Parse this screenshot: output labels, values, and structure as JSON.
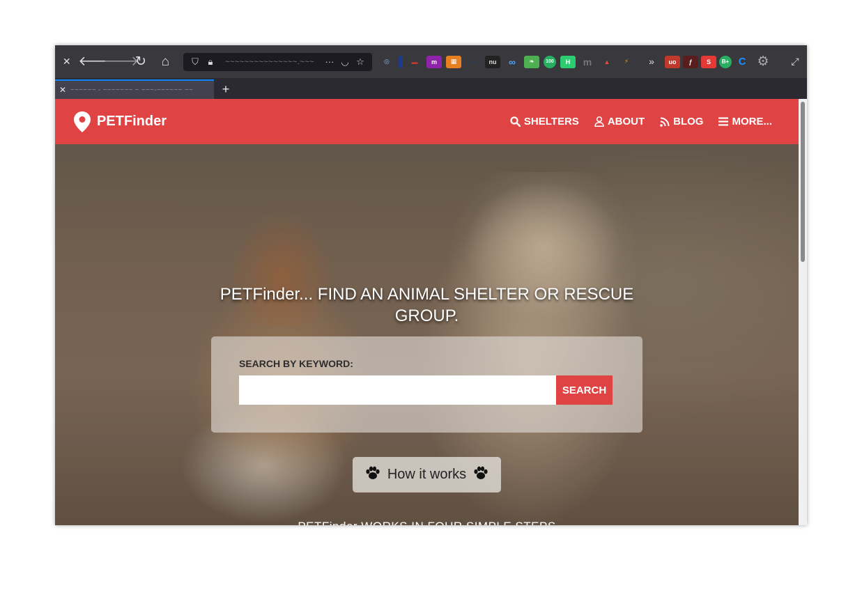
{
  "browser": {
    "tab_title": "~~~~~~ - ~~~~~~~ ~ ~~~-~~~~~~ ~~",
    "url_text": "~~~~~~~~~~~~~~~.~~~",
    "overflow_label": "···"
  },
  "navbar": {
    "brand": "PETFinder",
    "links": [
      {
        "label": "SHELTERS",
        "icon": "search-icon"
      },
      {
        "label": "ABOUT",
        "icon": "user-icon"
      },
      {
        "label": "BLOG",
        "icon": "rss-icon"
      },
      {
        "label": "MORE...",
        "icon": "menu-icon"
      }
    ]
  },
  "hero": {
    "title": "PETFinder... FIND AN ANIMAL SHELTER OR RESCUE GROUP.",
    "search_label": "SEARCH BY KEYWORD:",
    "search_placeholder": "",
    "search_button": "SEARCH",
    "how_it_works": "How it works",
    "bottom_text": "PETFinder WORKS IN FOUR SIMPLE STEPS"
  },
  "colors": {
    "brand_red": "#e04343",
    "toolbar": "#38383d"
  }
}
